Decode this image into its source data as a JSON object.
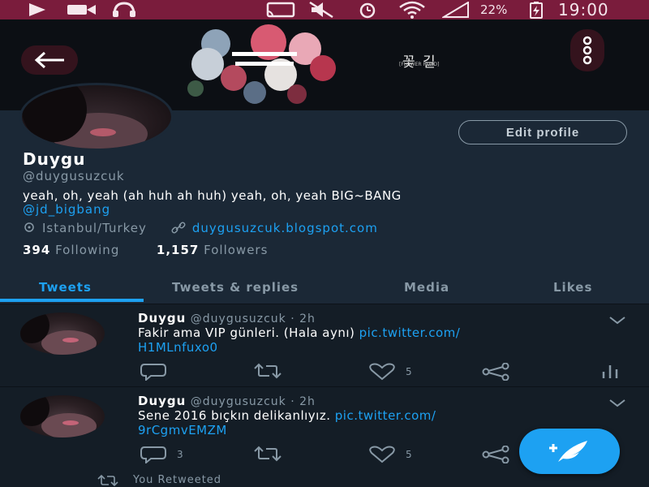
{
  "status_bar": {
    "battery": "22%",
    "time": "19:00"
  },
  "banner": {
    "album_title": "꽃 길",
    "album_subtitle": "[FLOWER ROAD]"
  },
  "profile": {
    "edit_button": "Edit profile",
    "name": "Duygu",
    "handle": "@duygusuzcuk",
    "bio": "yeah, oh, yeah (ah huh ah huh) yeah, oh, yeah BIG~BANG",
    "bio_mention": "@jd_bigbang",
    "location": "Istanbul/Turkey",
    "website": "duygusuzcuk.blogspot.com",
    "following_count": "394",
    "following_label": "Following",
    "followers_count": "1,157",
    "followers_label": "Followers"
  },
  "tabs": [
    {
      "label": "Tweets"
    },
    {
      "label": "Tweets & replies"
    },
    {
      "label": "Media"
    },
    {
      "label": "Likes"
    }
  ],
  "tweets": [
    {
      "name": "Duygu",
      "handle_time": "@duygusuzcuk · 2h",
      "text": "Fakir ama VIP günleri. (Hala aynı)",
      "link_part1": "pic.twitter.com/",
      "link_part2": "H1MLnfuxo0",
      "replies": "",
      "likes": "5"
    },
    {
      "name": "Duygu",
      "handle_time": "@duygusuzcuk · 2h",
      "text": "Sene 2016 bıçkın delikanlıyız.",
      "link_part1": "pic.twitter.com/",
      "link_part2": "9rCgmvEMZM",
      "replies": "3",
      "likes": "5"
    }
  ],
  "retweet_note": "You Retweeted",
  "colors": {
    "accent": "#1da1f2",
    "status_bar": "#7a1c3c",
    "profile_bg": "#1b2836",
    "feed_bg": "#141d26"
  }
}
